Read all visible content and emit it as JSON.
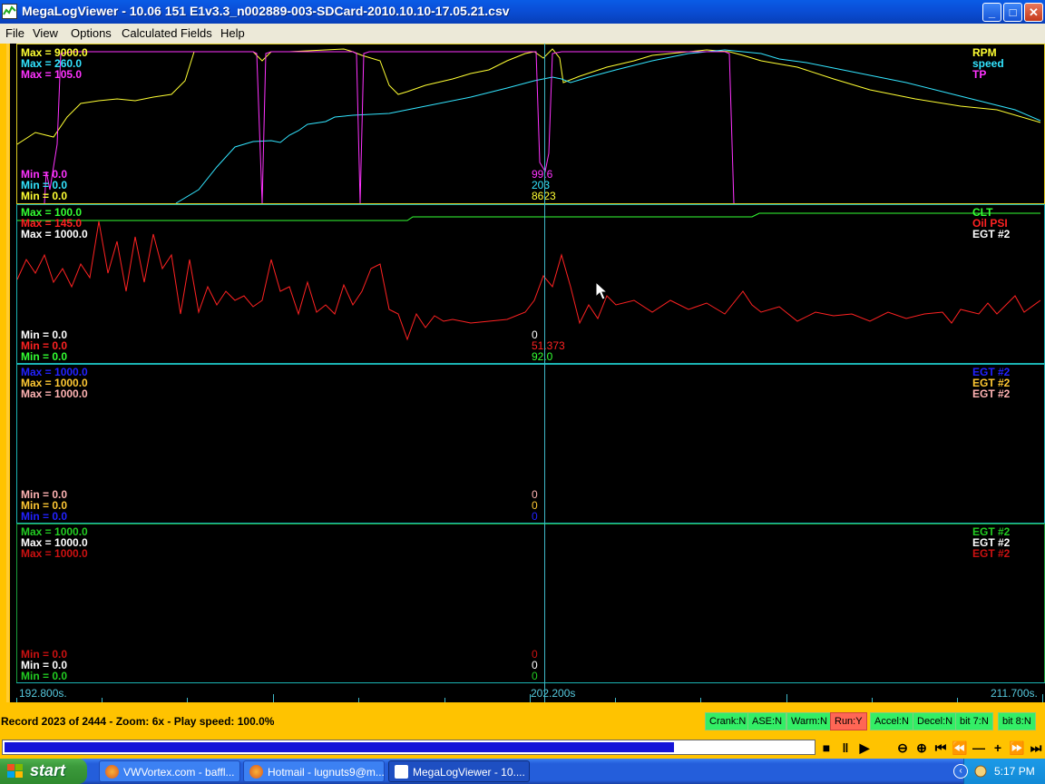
{
  "window": {
    "title": "MegaLogViewer - 10.06 151 E1v3.3_n002889-003-SDCard-2010.10.10-17.05.21.csv",
    "minimize_icon": "minimize-icon",
    "maximize_icon": "maximize-icon",
    "close_icon": "close-icon"
  },
  "menu": [
    "File",
    "View",
    "Options",
    "Calculated Fields",
    "Help"
  ],
  "panels": [
    {
      "max_labels": [
        {
          "text": "Max = 9000.0",
          "color": "#ffff33"
        },
        {
          "text": "Max = 260.0",
          "color": "#33e5ff"
        },
        {
          "text": "Max = 105.0",
          "color": "#ff33ff"
        }
      ],
      "min_labels": [
        {
          "text": "Min = 0.0",
          "color": "#ff33ff"
        },
        {
          "text": "Min = 0.0",
          "color": "#33e5ff"
        },
        {
          "text": "Min = 0.0",
          "color": "#ffff33"
        }
      ],
      "cursor_values": [
        {
          "text": "99.6",
          "color": "#ff33ff"
        },
        {
          "text": "203",
          "color": "#33e5ff"
        },
        {
          "text": "8623",
          "color": "#ffff33"
        }
      ],
      "series": [
        {
          "name": "RPM",
          "color": "#ffff33"
        },
        {
          "name": "speed",
          "color": "#33e5ff"
        },
        {
          "name": "TP",
          "color": "#ff33ff"
        }
      ]
    },
    {
      "max_labels": [
        {
          "text": "Max = 100.0",
          "color": "#33ff33"
        },
        {
          "text": "Max = 145.0",
          "color": "#ff2222"
        },
        {
          "text": "Max = 1000.0",
          "color": "#ffffff"
        }
      ],
      "min_labels": [
        {
          "text": "Min = 0.0",
          "color": "#ffffff"
        },
        {
          "text": "Min = 0.0",
          "color": "#ff2222"
        },
        {
          "text": "Min = 0.0",
          "color": "#33ff33"
        }
      ],
      "cursor_values": [
        {
          "text": "0",
          "color": "#ffffff"
        },
        {
          "text": "51.373",
          "color": "#ff2222"
        },
        {
          "text": "92.0",
          "color": "#33ff33"
        }
      ],
      "series": [
        {
          "name": "CLT",
          "color": "#33ff33"
        },
        {
          "name": "Oil PSI",
          "color": "#ff2222"
        },
        {
          "name": "EGT #2",
          "color": "#ffffff"
        }
      ]
    },
    {
      "max_labels": [
        {
          "text": "Max = 1000.0",
          "color": "#2222ff"
        },
        {
          "text": "Max = 1000.0",
          "color": "#ffc833"
        },
        {
          "text": "Max = 1000.0",
          "color": "#ffb3b3"
        }
      ],
      "min_labels": [
        {
          "text": "Min = 0.0",
          "color": "#ffb3b3"
        },
        {
          "text": "Min = 0.0",
          "color": "#ffc833"
        },
        {
          "text": "Min = 0.0",
          "color": "#2222ff"
        }
      ],
      "cursor_values": [
        {
          "text": "0",
          "color": "#ffb3b3"
        },
        {
          "text": "0",
          "color": "#ffc833"
        },
        {
          "text": "0",
          "color": "#2222ff"
        }
      ],
      "series": [
        {
          "name": "EGT #2",
          "color": "#2222ff"
        },
        {
          "name": "EGT #2",
          "color": "#ffc833"
        },
        {
          "name": "EGT #2",
          "color": "#ffb3b3"
        }
      ]
    },
    {
      "max_labels": [
        {
          "text": "Max = 1000.0",
          "color": "#22cc22"
        },
        {
          "text": "Max = 1000.0",
          "color": "#ffffff"
        },
        {
          "text": "Max = 1000.0",
          "color": "#cc1111"
        }
      ],
      "min_labels": [
        {
          "text": "Min = 0.0",
          "color": "#cc1111"
        },
        {
          "text": "Min = 0.0",
          "color": "#ffffff"
        },
        {
          "text": "Min = 0.0",
          "color": "#22cc22"
        }
      ],
      "cursor_values": [
        {
          "text": "0",
          "color": "#cc1111"
        },
        {
          "text": "0",
          "color": "#ffffff"
        },
        {
          "text": "0",
          "color": "#22cc22"
        }
      ],
      "series": [
        {
          "name": "EGT #2",
          "color": "#22cc22"
        },
        {
          "name": "EGT #2",
          "color": "#ffffff"
        },
        {
          "name": "EGT #2",
          "color": "#cc1111"
        }
      ]
    }
  ],
  "time_axis": {
    "start": "192.800s.",
    "cursor": "202.200s",
    "end": "211.700s."
  },
  "status": {
    "text": "Record 2023 of 2444 - Zoom: 6x - Play speed: 100.0%"
  },
  "flags": [
    {
      "label": "Crank:N",
      "on": false
    },
    {
      "label": "ASE:N",
      "on": false
    },
    {
      "label": "Warm:N",
      "on": false
    },
    {
      "label": "Run:Y",
      "on": true
    },
    {
      "label": "Accel:N",
      "on": false
    },
    {
      "label": "Decel:N",
      "on": false
    },
    {
      "label": "bit 7:N",
      "on": false
    },
    {
      "label": "bit 8:N",
      "on": false
    }
  ],
  "playback": {
    "progress_fraction": 0.828,
    "controls": [
      {
        "name": "stop-icon",
        "glyph": "■"
      },
      {
        "name": "pause-icon",
        "glyph": "‖"
      },
      {
        "name": "play-icon",
        "glyph": "▶"
      },
      {
        "name": "zoom-out-icon",
        "glyph": "⊖"
      },
      {
        "name": "zoom-in-icon",
        "glyph": "⊕"
      },
      {
        "name": "go-to-start-icon",
        "glyph": "⏮"
      },
      {
        "name": "rewind-icon",
        "glyph": "⏪"
      },
      {
        "name": "minus-icon",
        "glyph": "—"
      },
      {
        "name": "plus-icon",
        "glyph": "+"
      },
      {
        "name": "fast-forward-icon",
        "glyph": "⏩"
      },
      {
        "name": "go-to-end-icon",
        "glyph": "⏭"
      }
    ]
  },
  "taskbar": {
    "start_label": "start",
    "tasks": [
      {
        "label": "VWVortex.com - baffl...",
        "icon": "firefox-icon",
        "active": false
      },
      {
        "label": "Hotmail - lugnuts9@m...",
        "icon": "firefox-icon",
        "active": false
      },
      {
        "label": "MegaLogViewer - 10....",
        "icon": "megalogviewer-icon",
        "active": true
      }
    ],
    "clock": "5:17 PM"
  }
}
